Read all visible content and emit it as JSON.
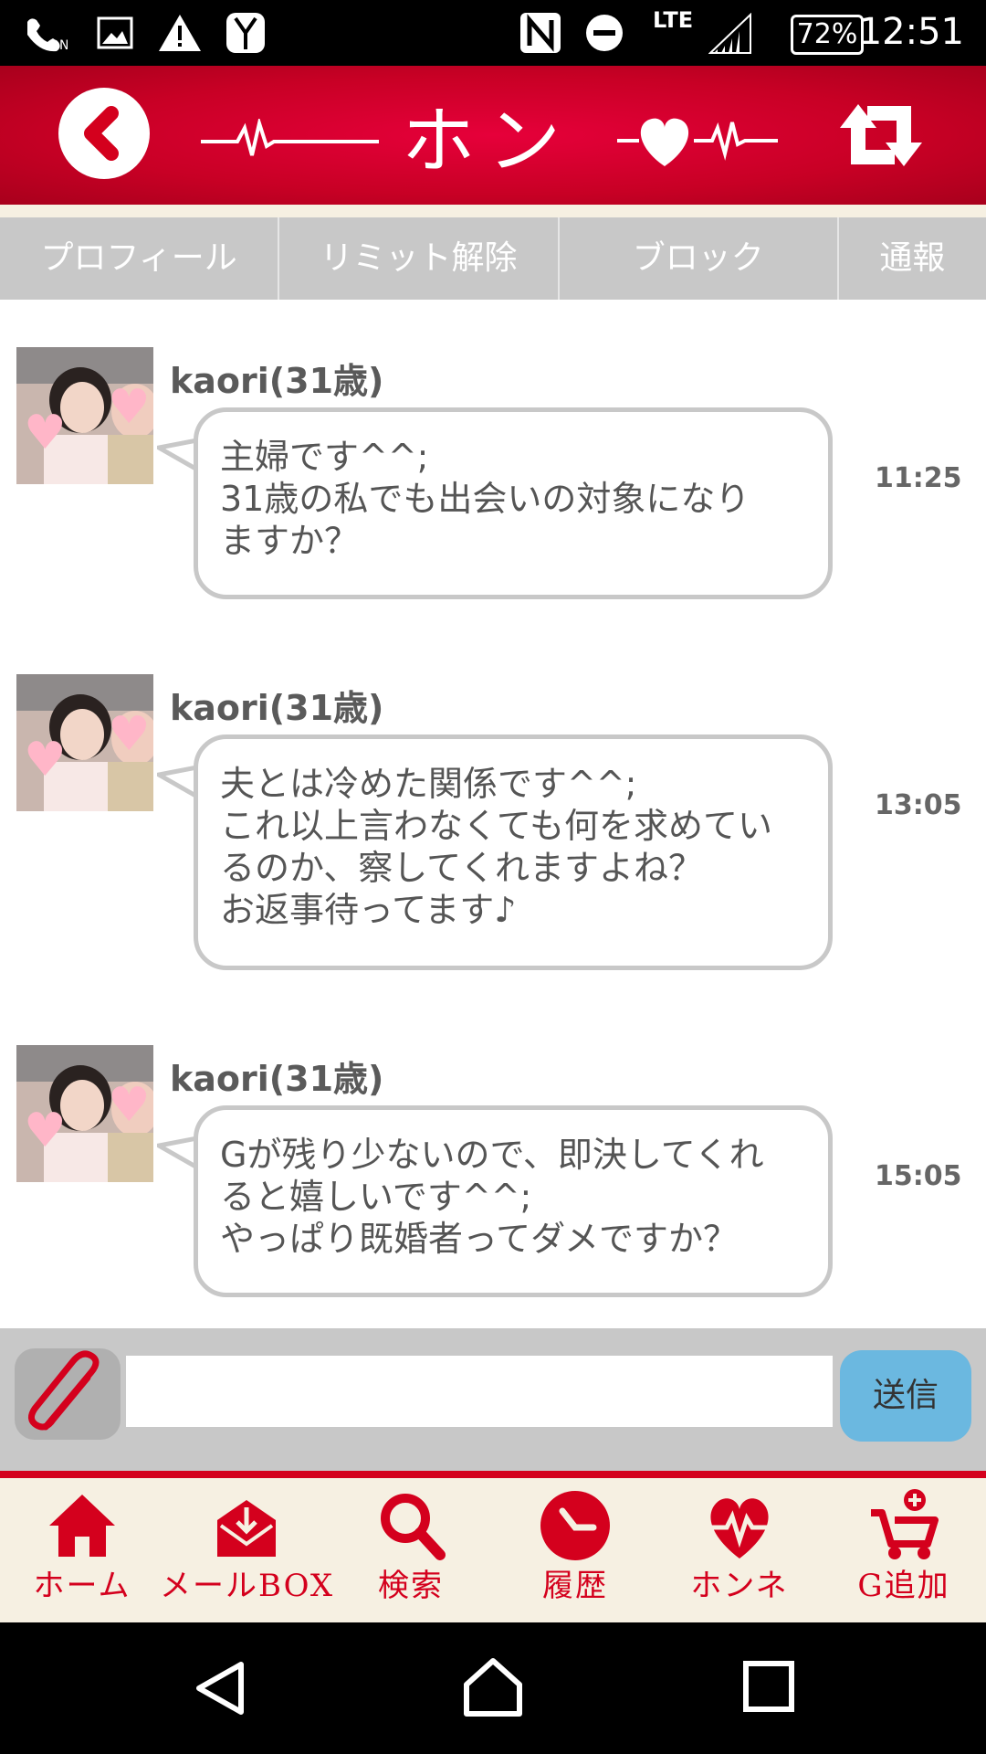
{
  "status_bar": {
    "time": "12:51",
    "battery": "72%",
    "network": "LTE",
    "icons": [
      "wifi-calling-icon",
      "image-icon",
      "warning-icon",
      "tuxedo-icon",
      "nfc-icon",
      "do-not-disturb-icon",
      "signal-icon",
      "battery-icon"
    ]
  },
  "header": {
    "logo_text": "ホンネ",
    "back_icon": "chevron-left-icon",
    "refresh_icon": "refresh-arrows-icon",
    "brand_color": "#d4001d"
  },
  "tabs": [
    {
      "label": "プロフィール"
    },
    {
      "label": "リミット解除"
    },
    {
      "label": "ブロック"
    },
    {
      "label": "通報"
    }
  ],
  "messages": [
    {
      "sender": "kaori(31歳)",
      "time": "11:25",
      "lines": [
        "主婦です^^;",
        "31歳の私でも出会いの対象になり",
        "ますか？"
      ]
    },
    {
      "sender": "kaori(31歳)",
      "time": "13:05",
      "lines": [
        "夫とは冷めた関係です^^;",
        "これ以上言わなくても何を求めてい",
        "るのか、察してくれますよね？",
        "お返事待ってます♪"
      ]
    },
    {
      "sender": "kaori(31歳)",
      "time": "15:05",
      "lines": [
        "Gが残り少ないので、即決してくれ",
        "ると嬉しいです^^;",
        "やっぱり既婚者ってダメですか？"
      ]
    }
  ],
  "input": {
    "value": "",
    "placeholder": "",
    "send_label": "送信",
    "attach_icon": "paperclip-icon"
  },
  "bottom_nav": [
    {
      "label": "ホーム",
      "icon": "home-icon"
    },
    {
      "label": "メールBOX",
      "icon": "mailbox-icon"
    },
    {
      "label": "検索",
      "icon": "search-icon"
    },
    {
      "label": "履歴",
      "icon": "clock-icon"
    },
    {
      "label": "ホンネ",
      "icon": "heart-pulse-icon"
    },
    {
      "label": "G追加",
      "icon": "cart-plus-icon"
    }
  ],
  "colors": {
    "accent": "#d4001d",
    "send_button": "#6bb8e0",
    "tab_bg": "#c8c8c8",
    "cream": "#f6f0e2"
  }
}
